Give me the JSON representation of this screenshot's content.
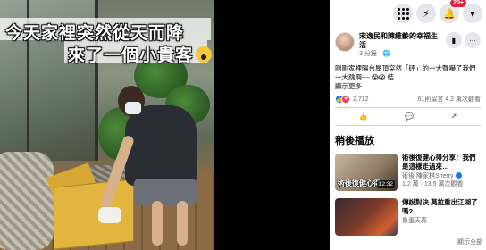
{
  "video": {
    "caption_line1": "今天家裡突然從天而降",
    "caption_line2": "來了一個小貴客"
  },
  "topbar": {
    "menu_icon": "grid-icon",
    "messenger_icon": "messenger-icon",
    "notifications_badge": "20+",
    "profile_icon": "account-icon"
  },
  "post": {
    "author": "宋逸民和陳維齡的幸福生活",
    "time": "3 分鐘 · 🌐",
    "text": "剛剛家裡陽台屋頂突然「砰」的一大聲嚇了我們一大跳啊~~ 😱😱 結…",
    "see_more": "顯示更多",
    "reaction_count": "2,712",
    "stats": "61則留言 4.2 萬次觀看",
    "actions": {
      "like": "讚",
      "comment": "留言",
      "share": "分享"
    }
  },
  "up_next": {
    "title": "稍後播放",
    "items": [
      {
        "thumb_text": "術後復健心得",
        "duration": "12:32",
        "title": "術後復健心得分享！我們是這樣走過來…",
        "channel": "術後 陳家棋Sherry",
        "views": "1.2 萬 · 13.5 萬次觀看"
      },
      {
        "thumb_text": "",
        "duration": "",
        "title": "傳說對決 莫拉重出江湖了嗎?",
        "channel": "魯蛋天真"
      }
    ],
    "show_all": "顯示全部"
  }
}
